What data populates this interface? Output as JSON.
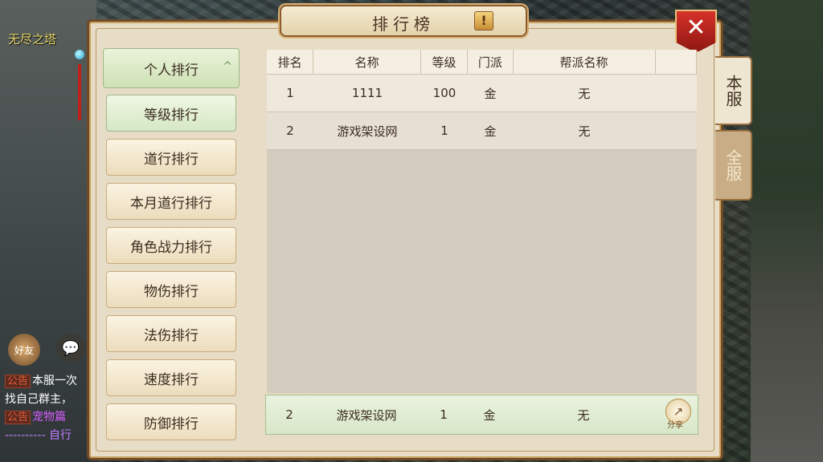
{
  "scene": {
    "location": "无尽之塔",
    "friend_label": "好友",
    "chat_icon": "chat-bubble-icon",
    "chat": [
      {
        "tag": "公告",
        "text": "本服一次"
      },
      {
        "tag": "",
        "text": "找自己群主，"
      },
      {
        "tag": "公告",
        "text": "宠物篇"
      },
      {
        "tag": "",
        "text": "---------- 自行"
      }
    ]
  },
  "window": {
    "title": "排行榜",
    "help_symbol": "!",
    "close_symbol": "✕"
  },
  "categories": {
    "header": "个人排行",
    "header_chevron": "^",
    "items": [
      "等级排行",
      "道行排行",
      "本月道行排行",
      "角色战力排行",
      "物伤排行",
      "法伤排行",
      "速度排行",
      "防御排行"
    ]
  },
  "table": {
    "columns": [
      "排名",
      "名称",
      "等级",
      "门派",
      "帮派名称",
      ""
    ],
    "rows": [
      {
        "rank": "1",
        "name": "1111",
        "level": "100",
        "sect": "金",
        "guild": "无"
      },
      {
        "rank": "2",
        "name": "游戏架设网",
        "level": "1",
        "sect": "金",
        "guild": "无"
      }
    ]
  },
  "my_rank": {
    "rank": "2",
    "name": "游戏架设网",
    "level": "1",
    "sect": "金",
    "guild": "无",
    "share_label": "分享"
  },
  "tabs": {
    "server": "本服",
    "all": "全服"
  },
  "colors": {
    "accent_green": "#d5e8c4",
    "close_red": "#c2271f",
    "frame_brown": "#6f4a28"
  }
}
